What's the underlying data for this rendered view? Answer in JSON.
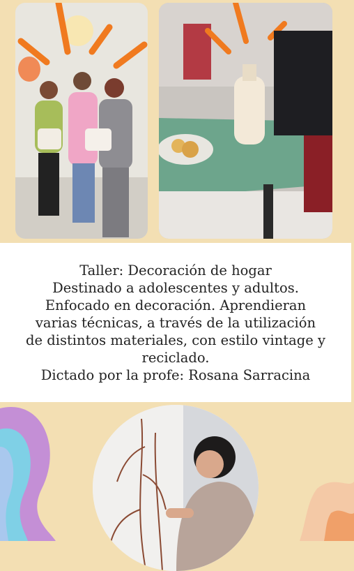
{
  "caption": {
    "lines": [
      "Taller: Decoración de hogar",
      "Destinado a adolescentes y adultos.",
      "Enfocado en decoración. Aprendieran",
      "varias técnicas, a través  de la utilización",
      "de distintos materiales, con estilo vintage y",
      "reciclado.",
      "Dictado por la profe: Rosana Sarracina"
    ]
  },
  "colors": {
    "background": "#f3dfb3",
    "accent_orange": "#f07a1f",
    "wave_purple": "#c48fd6",
    "wave_blue": "#7fd0e6"
  },
  "photos": [
    {
      "subject": "three-women-holding-decorated-boxes"
    },
    {
      "subject": "decorated-bottle-on-table"
    },
    {
      "subject": "woman-painting-wall-mural"
    }
  ]
}
